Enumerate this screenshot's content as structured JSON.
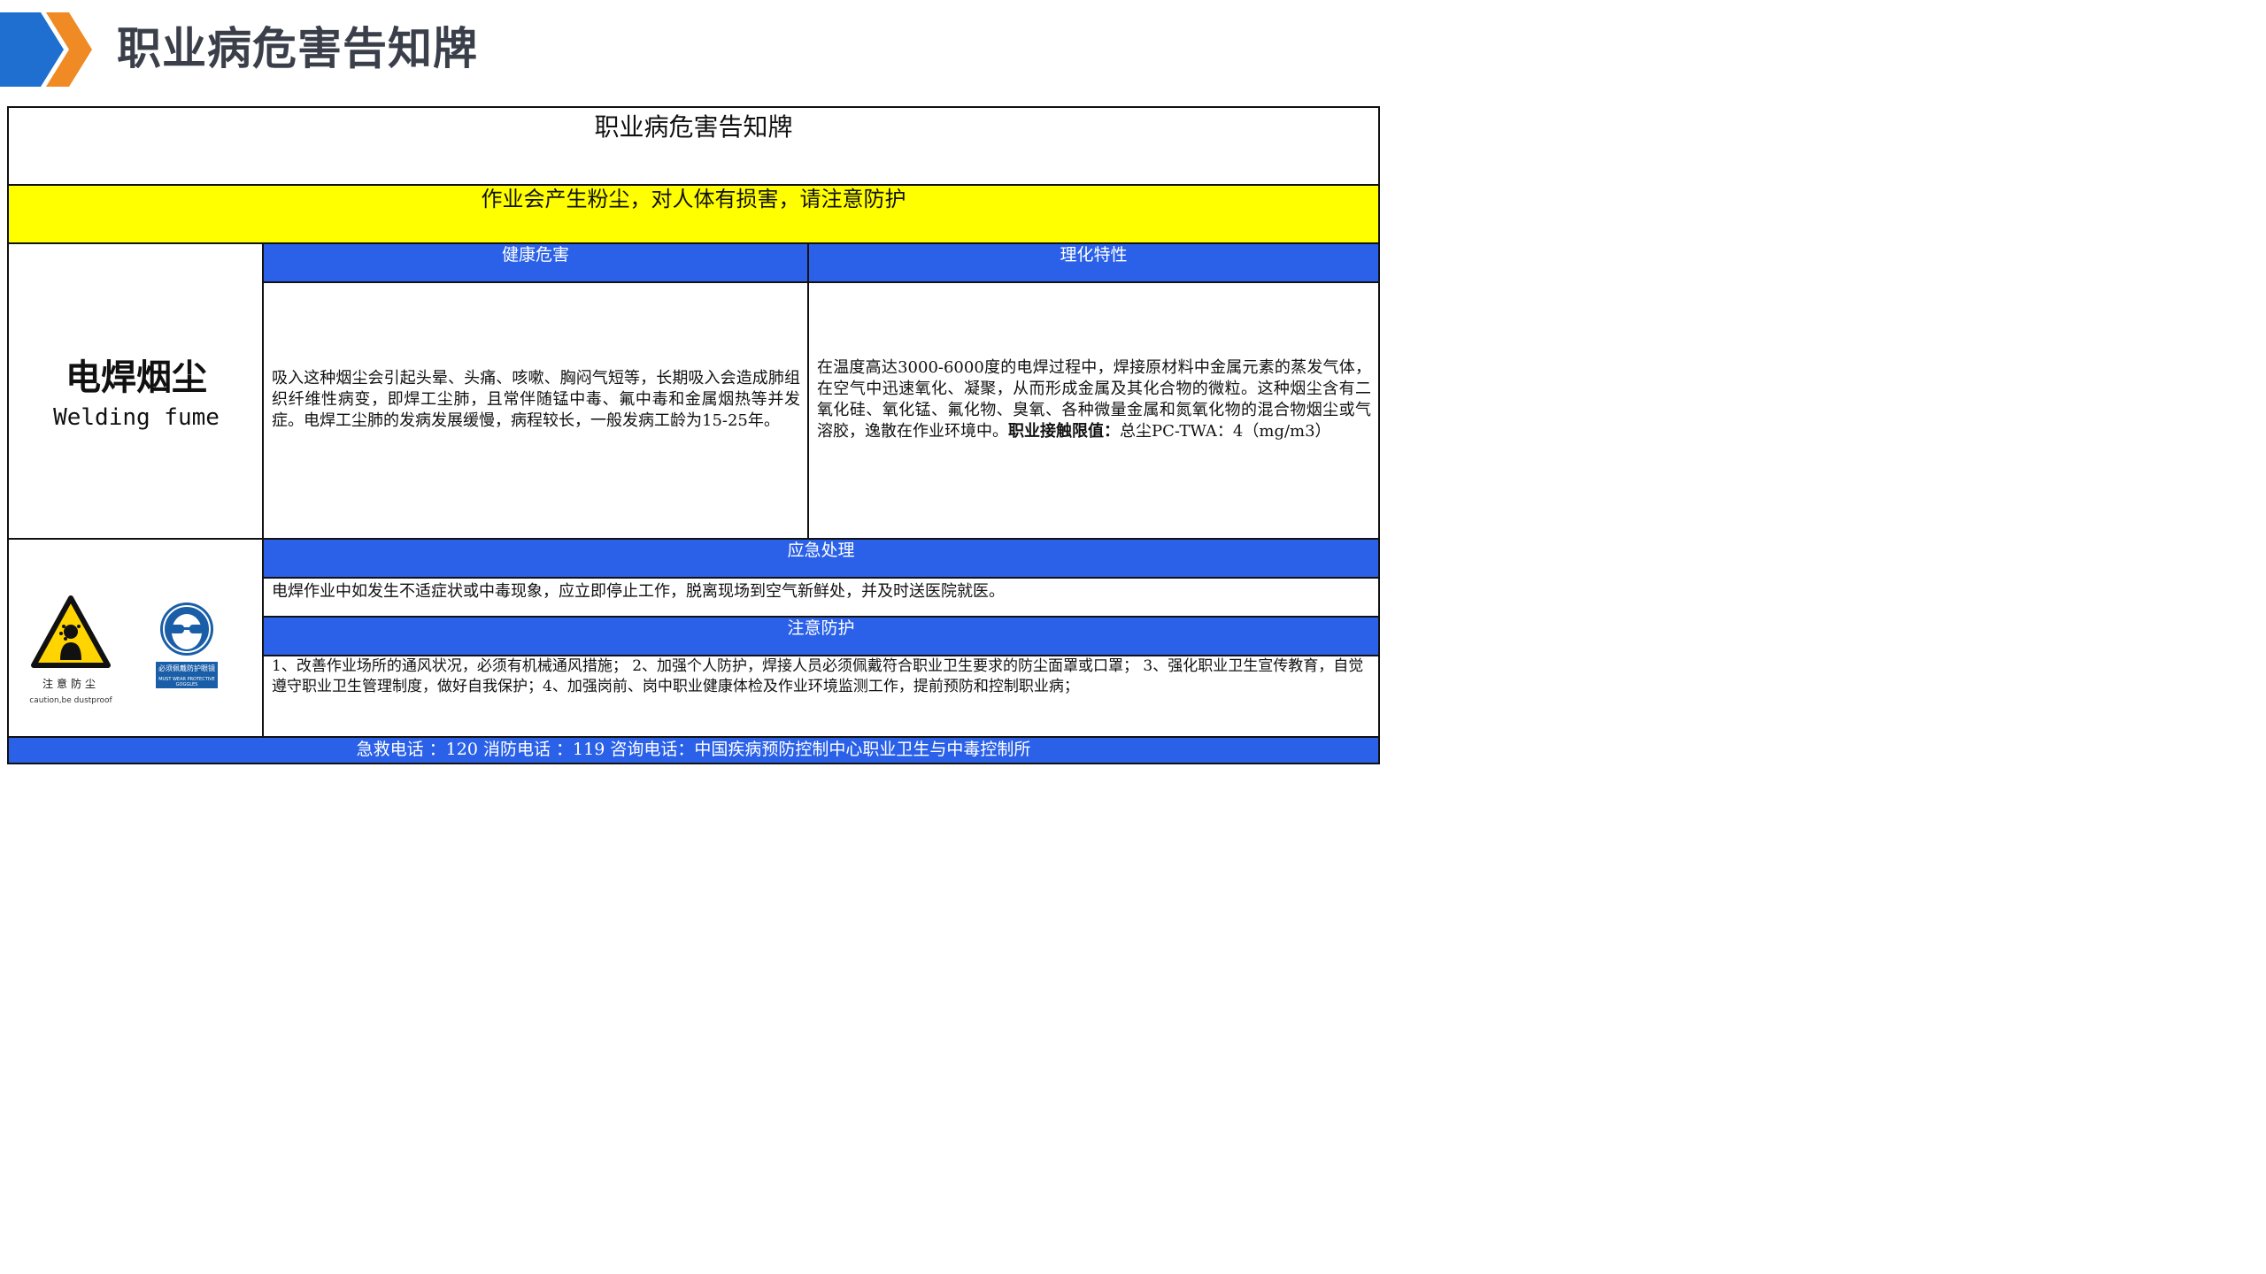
{
  "page": {
    "title": "职业病危害告知牌"
  },
  "board": {
    "title": "职业病危害告知牌",
    "warning": "作业会产生粉尘，对人体有损害，请注意防护",
    "hazard_name_cn": "电焊烟尘",
    "hazard_name_en": "Welding fume",
    "health_header": "健康危害",
    "health_text": "吸入这种烟尘会引起头晕、头痛、咳嗽、胸闷气短等，长期吸入会造成肺组织纤维性病变，即焊工尘肺，且常伴随锰中毒、氟中毒和金属烟热等并发症。电焊工尘肺的发病发展缓慢，病程较长，一般发病工龄为15-25年。",
    "property_header": "理化特性",
    "property_text": "在温度高达3000-6000度的电焊过程中，焊接原材料中金属元素的蒸发气体，在空气中迅速氧化、凝聚，从而形成金属及其化合物的微粒。这种烟尘含有二氧化硅、氧化锰、氟化物、臭氧、各种微量金属和氮氧化物的混合物烟尘或气溶胶，逸散在作业环境中。",
    "property_limit_label": "职业接触限值：",
    "property_limit_value": "总尘PC-TWA：4（mg/m3）",
    "emergency_header": "应急处理",
    "emergency_text": "电焊作业中如发生不适症状或中毒现象，应立即停止工作，脱离现场到空气新鲜处，并及时送医院就医。",
    "protection_header": "注意防护",
    "protection_text": "1、改善作业场所的通风状况，必须有机械通风措施；  2、加强个人防护，焊接人员必须佩戴符合职业卫生要求的防尘面罩或口罩；  3、强化职业卫生宣传教育，自觉遵守职业卫生管理制度，做好自我保护；4、加强岗前、岗中职业健康体检及作业环境监测工作，提前预防和控制职业病；",
    "footer": "急救电话 ：120  消防电话 ：119  咨询电话：中国疾病预防控制中心职业卫生与中毒控制所"
  },
  "signs": {
    "caution_label_cn": "注意防尘",
    "caution_label_en": "caution,be dustproof",
    "goggles_label": "必须佩戴防护眼镜",
    "goggles_label_en": "MUST WEAR PROTECTIVE GOGGLES"
  },
  "colors": {
    "header_blue": "#2b61e8",
    "warning_yellow": "#ffff00",
    "chevron_blue": "#1f6fd0",
    "chevron_orange": "#f08a24"
  }
}
